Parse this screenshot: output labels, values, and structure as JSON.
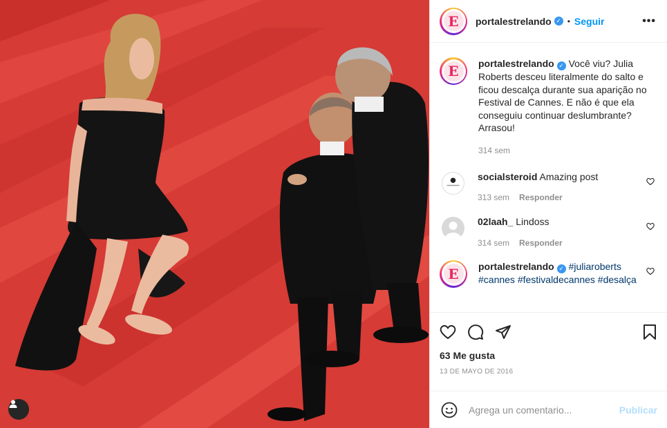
{
  "post": {
    "account": "portalestrelando",
    "follow_label": "Seguir",
    "more_label": "•••",
    "caption": "Você viu? Julia Roberts desceu literalmente do salto e ficou descalça durante sua aparição no Festival de Cannes. E não é que ela conseguiu continuar deslumbrante? Arrasou!",
    "caption_time": "314 sem"
  },
  "comments": [
    {
      "user": "socialsteroid",
      "text": "Amazing post",
      "time": "313 sem",
      "reply_label": "Responder",
      "avatar_text": "Social Steroid"
    },
    {
      "user": "02laah_",
      "text": "Lindoss",
      "time": "314 sem",
      "reply_label": "Responder"
    },
    {
      "user": "portalestrelando",
      "hashtags_line1": "#juliaroberts",
      "hashtags_line2": "#cannes #festivaldecannes #desalça"
    }
  ],
  "actions": {
    "icons": [
      "heart-icon",
      "comment-icon",
      "share-icon",
      "bookmark-icon"
    ],
    "likes": "63 Me gusta",
    "date": "13 DE MAYO DE 2016"
  },
  "composer": {
    "placeholder": "Agrega un comentario...",
    "publish_label": "Publicar"
  },
  "colors": {
    "accent": "#0095f6",
    "verified": "#3897f0",
    "carpet": "#d83a34"
  }
}
